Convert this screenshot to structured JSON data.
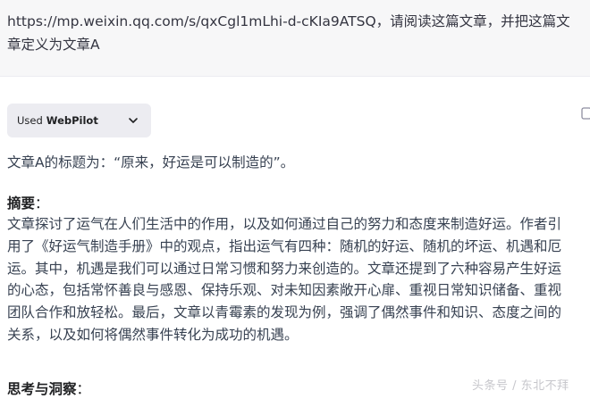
{
  "user_message": {
    "text": "https://mp.weixin.qq.com/s/qxCgl1mLhi-d-cKIa9ATSQ，请阅读这篇文章，并把这篇文章定义为文章A"
  },
  "plugin_chip": {
    "used_label": "Used",
    "plugin_name": "WebPilot"
  },
  "answer": {
    "title_line": "文章A的标题为：“原来，好运是可以制造的”。",
    "summary_heading": "摘要",
    "summary_colon": "：",
    "summary_lines": [
      "文章探讨了运气在人们生活中的作用，以及如何通过自己的努力和态度来制造好运。作者引",
      "用了《好运气制造手册》中的观点，指出运气有四种：随机的好运、随机的坏运、机遇和厄",
      "运。其中，机遇是我们可以通过日常习惯和努力来创造的。文章还提到了六种容易产生好运",
      "的心态，包括常怀善良与感恩、保持乐观、对未知因素敞开心扉、重视日常知识储备、重视",
      "团队合作和放轻松。最后，文章以青霉素的发现为例，强调了偶然事件和知识、态度之间的",
      "关系，以及如何将偶然事件转化为成功的机遇。"
    ],
    "insight_heading": "思考与洞察",
    "insight_colon": "："
  },
  "watermark": {
    "text": "头条号 / 东北不拜"
  },
  "icons": {
    "chevron": "chevron-down-icon",
    "copy": "copy-icon"
  }
}
